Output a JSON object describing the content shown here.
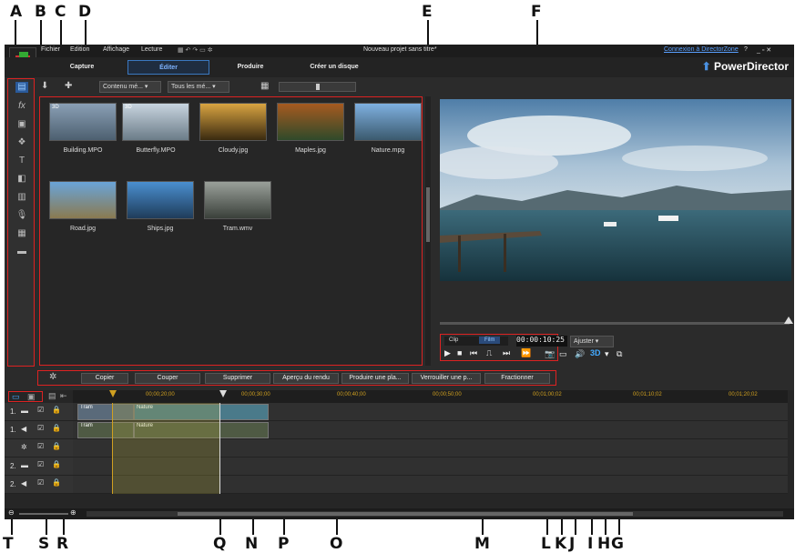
{
  "callouts": {
    "top": [
      "A",
      "B",
      "C",
      "D",
      "E",
      "F"
    ],
    "bottom": [
      "T",
      "S",
      "R",
      "Q",
      "N",
      "P",
      "O",
      "M",
      "L",
      "K",
      "J",
      "I",
      "H",
      "G"
    ]
  },
  "menu": {
    "items": [
      "Fichier",
      "Edition",
      "Affichage",
      "Lecture"
    ],
    "project_title": "Nouveau projet sans titre*",
    "connect_link": "Connexion à DirectorZone",
    "help": "?"
  },
  "modes": {
    "capture": "Capture",
    "edit": "Éditer",
    "produce": "Produire",
    "disc": "Créer un disque"
  },
  "brand": "PowerDirector",
  "library_toolbar": {
    "content_filter": "Contenu mé...",
    "media_filter": "Tous les mé..."
  },
  "media": [
    {
      "name": "Building.MPO",
      "badge": "3D",
      "color1": "#8a9fb5",
      "color2": "#4d6070"
    },
    {
      "name": "Butterfly.MPO",
      "badge": "3D",
      "color1": "#c8d4df",
      "color2": "#6b7c88"
    },
    {
      "name": "Cloudy.jpg",
      "badge": "",
      "color1": "#d9a441",
      "color2": "#3a2a10"
    },
    {
      "name": "Maples.jpg",
      "badge": "",
      "color1": "#a65a20",
      "color2": "#2f4a2a"
    },
    {
      "name": "Nature.mpg",
      "badge": "",
      "color1": "#7fb0e0",
      "color2": "#3b5a6e"
    },
    {
      "name": "Road.jpg",
      "badge": "",
      "color1": "#6aa4d8",
      "color2": "#8a7a50"
    },
    {
      "name": "Ships.jpg",
      "badge": "",
      "color1": "#4a8fd0",
      "color2": "#1f3c5a"
    },
    {
      "name": "Tram.wmv",
      "badge": "",
      "color1": "#9aa09a",
      "color2": "#3a403a"
    }
  ],
  "player": {
    "clip_tab": "Clip",
    "film_tab": "Film",
    "timecode": "00:00:10:25",
    "fit": "Ajuster",
    "three_d": "3D"
  },
  "edit_buttons": [
    "Copier",
    "Couper",
    "Supprimer",
    "Aperçu du rendu",
    "Produire une pla...",
    "Verrouiller une p...",
    "Fractionner"
  ],
  "ruler": [
    "00;00;20;00",
    "00;00;30;00",
    "00;00;40;00",
    "00;00;50;00",
    "00;01;00;02",
    "00;01;10;02",
    "00;01;20;02"
  ],
  "tracks": [
    {
      "num": "1.",
      "clips": [
        {
          "label": "Tram"
        },
        {
          "label": "Nature"
        }
      ]
    },
    {
      "num": "1.",
      "clips": [
        {
          "label": "Tram"
        },
        {
          "label": "Nature"
        }
      ]
    },
    {
      "num": "",
      "clips": []
    },
    {
      "num": "2.",
      "clips": []
    },
    {
      "num": "2.",
      "clips": []
    }
  ]
}
